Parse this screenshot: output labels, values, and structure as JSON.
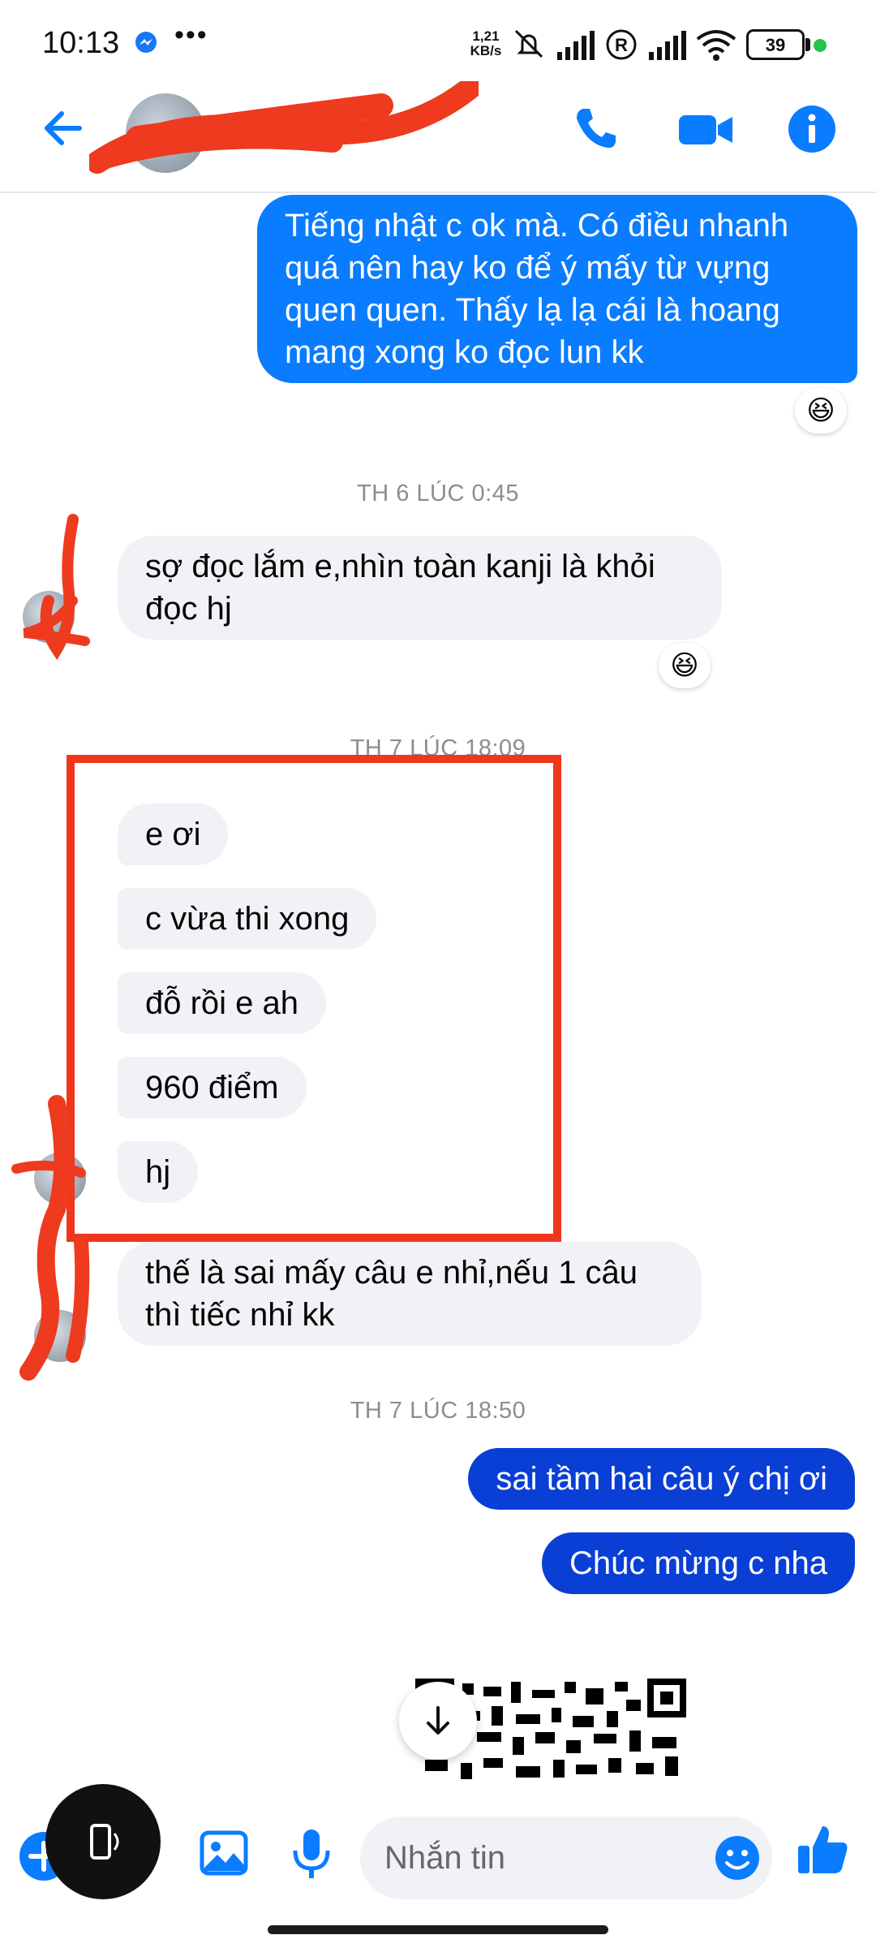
{
  "status_bar": {
    "time": "10:13",
    "dots": "•••",
    "net_speed_value": "1,21",
    "net_speed_unit": "KB/s",
    "battery": "39"
  },
  "header": {
    "contact_name": "",
    "icons": [
      "back-arrow-icon",
      "phone-icon",
      "video-camera-icon",
      "info-icon"
    ]
  },
  "messages": {
    "m1": "Tiếng nhật c ok mà. Có điều nhanh quá nên hay ko để ý mấy từ vựng quen quen. Thấy lạ lạ cái là hoang mang xong ko đọc lun kk",
    "m1_reaction": "😆",
    "ts1": "TH 6 LÚC 0:45",
    "m2": "sợ đọc lắm e,nhìn toàn kanji là khỏi đọc hj",
    "m2_reaction": "😆",
    "ts2": "TH 7 LÚC 18:09",
    "m3": "e ơi",
    "m4": "c vừa thi xong",
    "m5": "đỗ rồi e ah",
    "m6": "960 điểm",
    "m7": "hj",
    "m8": "thế là sai mấy câu e nhỉ,nếu 1 câu thì tiếc nhỉ kk",
    "ts3": "TH 7 LÚC 18:50",
    "m9": "sai tầm hai câu ý chị ơi",
    "m10": "Chúc mừng c nha"
  },
  "composer": {
    "placeholder": "Nhắn tin"
  },
  "colors": {
    "accent": "#0a7cff",
    "sent_dark": "#0a3fd6",
    "received_bg": "#f0f2f5",
    "highlight": "#f0361d",
    "redaction": "#ee3a1e"
  }
}
